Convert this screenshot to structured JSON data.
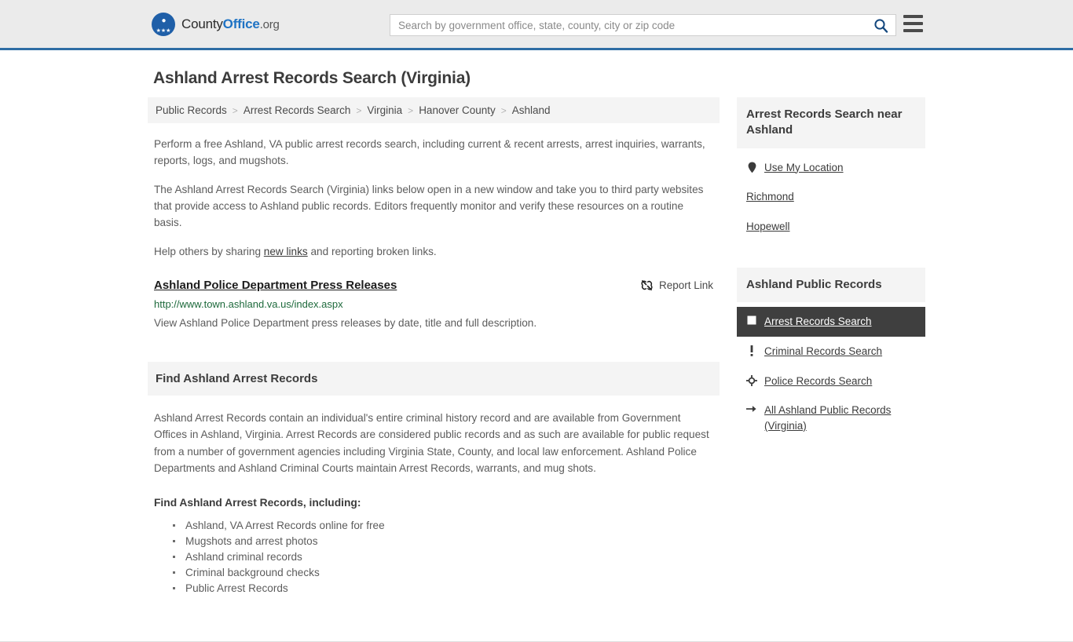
{
  "header": {
    "brand": {
      "part1": "County",
      "part2": "Office",
      "part3": ".org",
      "logo_icon": "eagle-stars-badge"
    },
    "search": {
      "placeholder": "Search by government office, state, county, city or zip code",
      "value": "",
      "search_icon": "search-icon"
    },
    "menu_icon": "hamburger-menu-icon"
  },
  "page": {
    "title": "Ashland Arrest Records Search (Virginia)"
  },
  "breadcrumb": {
    "items": [
      "Public Records",
      "Arrest Records Search",
      "Virginia",
      "Hanover County",
      "Ashland"
    ],
    "separator": ">"
  },
  "intro": {
    "p1": "Perform a free Ashland, VA public arrest records search, including current & recent arrests, arrest inquiries, warrants, reports, logs, and mugshots.",
    "p2": "The Ashland Arrest Records Search (Virginia) links below open in a new window and take you to third party websites that provide access to Ashland public records. Editors frequently monitor and verify these resources on a routine basis.",
    "p3_before": "Help others by sharing ",
    "p3_link": "new links",
    "p3_after": " and reporting broken links."
  },
  "result": {
    "title": "Ashland Police Department Press Releases",
    "url": "http://www.town.ashland.va.us/index.aspx",
    "description": "View Ashland Police Department press releases by date, title and full description.",
    "report_label": "Report Link",
    "report_icon": "broken-link-icon"
  },
  "find_section": {
    "heading": "Find Ashland Arrest Records",
    "paragraph": "Ashland Arrest Records contain an individual's entire criminal history record and are available from Government Offices in Ashland, Virginia. Arrest Records are considered public records and as such are available for public request from a number of government agencies including Virginia State, County, and local law enforcement. Ashland Police Departments and Ashland Criminal Courts maintain Arrest Records, warrants, and mug shots.",
    "sub_heading": "Find Ashland Arrest Records, including:",
    "bullets": [
      "Ashland, VA Arrest Records online for free",
      "Mugshots and arrest photos",
      "Ashland criminal records",
      "Criminal background checks",
      "Public Arrest Records"
    ]
  },
  "sidebar": {
    "near": {
      "heading": "Arrest Records Search near Ashland",
      "items": [
        {
          "label": "Use My Location",
          "icon": "map-pin-icon"
        },
        {
          "label": "Richmond",
          "icon": ""
        },
        {
          "label": "Hopewell",
          "icon": ""
        }
      ]
    },
    "public_records": {
      "heading": "Ashland Public Records",
      "items": [
        {
          "label": "Arrest Records Search",
          "icon": "square-icon",
          "active": true
        },
        {
          "label": "Criminal Records Search",
          "icon": "exclamation-icon",
          "active": false
        },
        {
          "label": "Police Records Search",
          "icon": "crosshair-icon",
          "active": false
        },
        {
          "label": "All Ashland Public Records (Virginia)",
          "icon": "arrow-right-icon",
          "active": false
        }
      ]
    }
  },
  "colors": {
    "header_bg": "#ebebeb",
    "header_border": "#2e6da4",
    "brand_blue": "#1f73c4",
    "url_green": "#1e6a3c",
    "active_bg": "#3f3f3f",
    "panel_bg": "#f4f4f4"
  }
}
